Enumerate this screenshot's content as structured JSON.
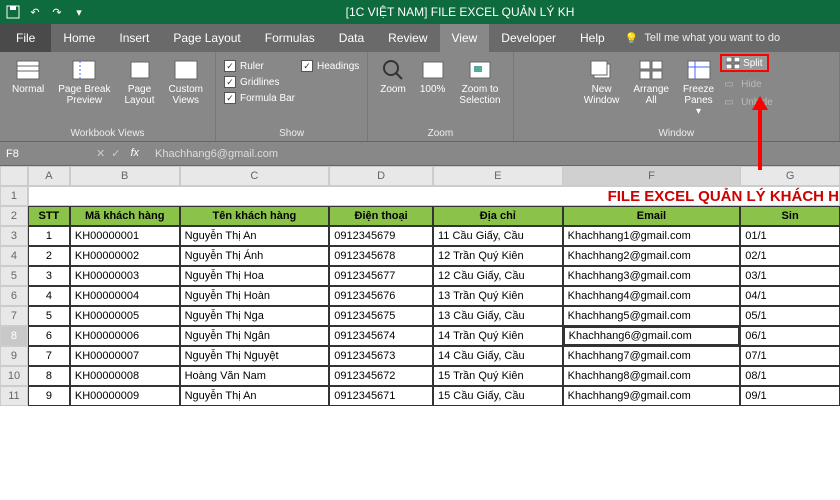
{
  "title": "[1C VIỆT NAM] FILE EXCEL QUẢN LÝ KH",
  "menu": {
    "file": "File",
    "home": "Home",
    "insert": "Insert",
    "page_layout": "Page Layout",
    "formulas": "Formulas",
    "data": "Data",
    "review": "Review",
    "view": "View",
    "developer": "Developer",
    "help": "Help",
    "tellme": "Tell me what you want to do"
  },
  "ribbon": {
    "views": {
      "normal": "Normal",
      "pbp": "Page Break\nPreview",
      "pl": "Page\nLayout",
      "cv": "Custom\nViews",
      "group": "Workbook Views"
    },
    "show": {
      "ruler": "Ruler",
      "gridlines": "Gridlines",
      "formula_bar": "Formula Bar",
      "headings": "Headings",
      "group": "Show"
    },
    "zoom": {
      "zoom": "Zoom",
      "hundred": "100%",
      "zts": "Zoom to\nSelection",
      "group": "Zoom"
    },
    "window": {
      "new": "New\nWindow",
      "arrange": "Arrange\nAll",
      "freeze": "Freeze\nPanes",
      "split": "Split",
      "hide": "Hide",
      "unhide": "Unhide",
      "group": "Window"
    }
  },
  "namebox": "F8",
  "formula": "Khachhang6@gmail.com",
  "cols": [
    "A",
    "B",
    "C",
    "D",
    "E",
    "F",
    "G"
  ],
  "row1_title": "FILE EXCEL QUẢN LÝ KHÁCH H",
  "headers": {
    "stt": "STT",
    "ma": "Mã khách hàng",
    "ten": "Tên khách hàng",
    "dt": "Điện thoại",
    "dc": "Địa chỉ",
    "em": "Email",
    "sin": "Sin"
  },
  "data": [
    {
      "n": 1,
      "ma": "KH00000001",
      "ten": "Nguyễn Thị An",
      "dt": "0912345679",
      "dc": "11 Cầu Giấy, Cầu",
      "em": "Khachhang1@gmail.com",
      "sin": "01/1"
    },
    {
      "n": 2,
      "ma": "KH00000002",
      "ten": "Nguyễn Thị Ánh",
      "dt": "0912345678",
      "dc": "12 Trần Quý Kiên",
      "em": "Khachhang2@gmail.com",
      "sin": "02/1"
    },
    {
      "n": 3,
      "ma": "KH00000003",
      "ten": "Nguyễn Thị Hoa",
      "dt": "0912345677",
      "dc": "12 Cầu Giấy, Cầu",
      "em": "Khachhang3@gmail.com",
      "sin": "03/1"
    },
    {
      "n": 4,
      "ma": "KH00000004",
      "ten": "Nguyễn Thị Hoàn",
      "dt": "0912345676",
      "dc": "13 Trần Quý Kiên",
      "em": "Khachhang4@gmail.com",
      "sin": "04/1"
    },
    {
      "n": 5,
      "ma": "KH00000005",
      "ten": "Nguyễn Thị Nga",
      "dt": "0912345675",
      "dc": "13 Cầu Giấy, Cầu",
      "em": "Khachhang5@gmail.com",
      "sin": "05/1"
    },
    {
      "n": 6,
      "ma": "KH00000006",
      "ten": "Nguyễn Thị Ngân",
      "dt": "0912345674",
      "dc": "14 Trần Quý Kiên",
      "em": "Khachhang6@gmail.com",
      "sin": "06/1"
    },
    {
      "n": 7,
      "ma": "KH00000007",
      "ten": "Nguyễn Thị Nguyệt",
      "dt": "0912345673",
      "dc": "14 Cầu Giấy, Cầu",
      "em": "Khachhang7@gmail.com",
      "sin": "07/1"
    },
    {
      "n": 8,
      "ma": "KH00000008",
      "ten": "Hoàng Văn Nam",
      "dt": "0912345672",
      "dc": "15 Trần Quý Kiên",
      "em": "Khachhang8@gmail.com",
      "sin": "08/1"
    },
    {
      "n": 9,
      "ma": "KH00000009",
      "ten": "Nguyễn Thị An",
      "dt": "0912345671",
      "dc": "15 Cầu Giấy, Cầu",
      "em": "Khachhang9@gmail.com",
      "sin": "09/1"
    }
  ],
  "row_nums": [
    1,
    2,
    3,
    4,
    5,
    6,
    7,
    8,
    9,
    10,
    11
  ]
}
